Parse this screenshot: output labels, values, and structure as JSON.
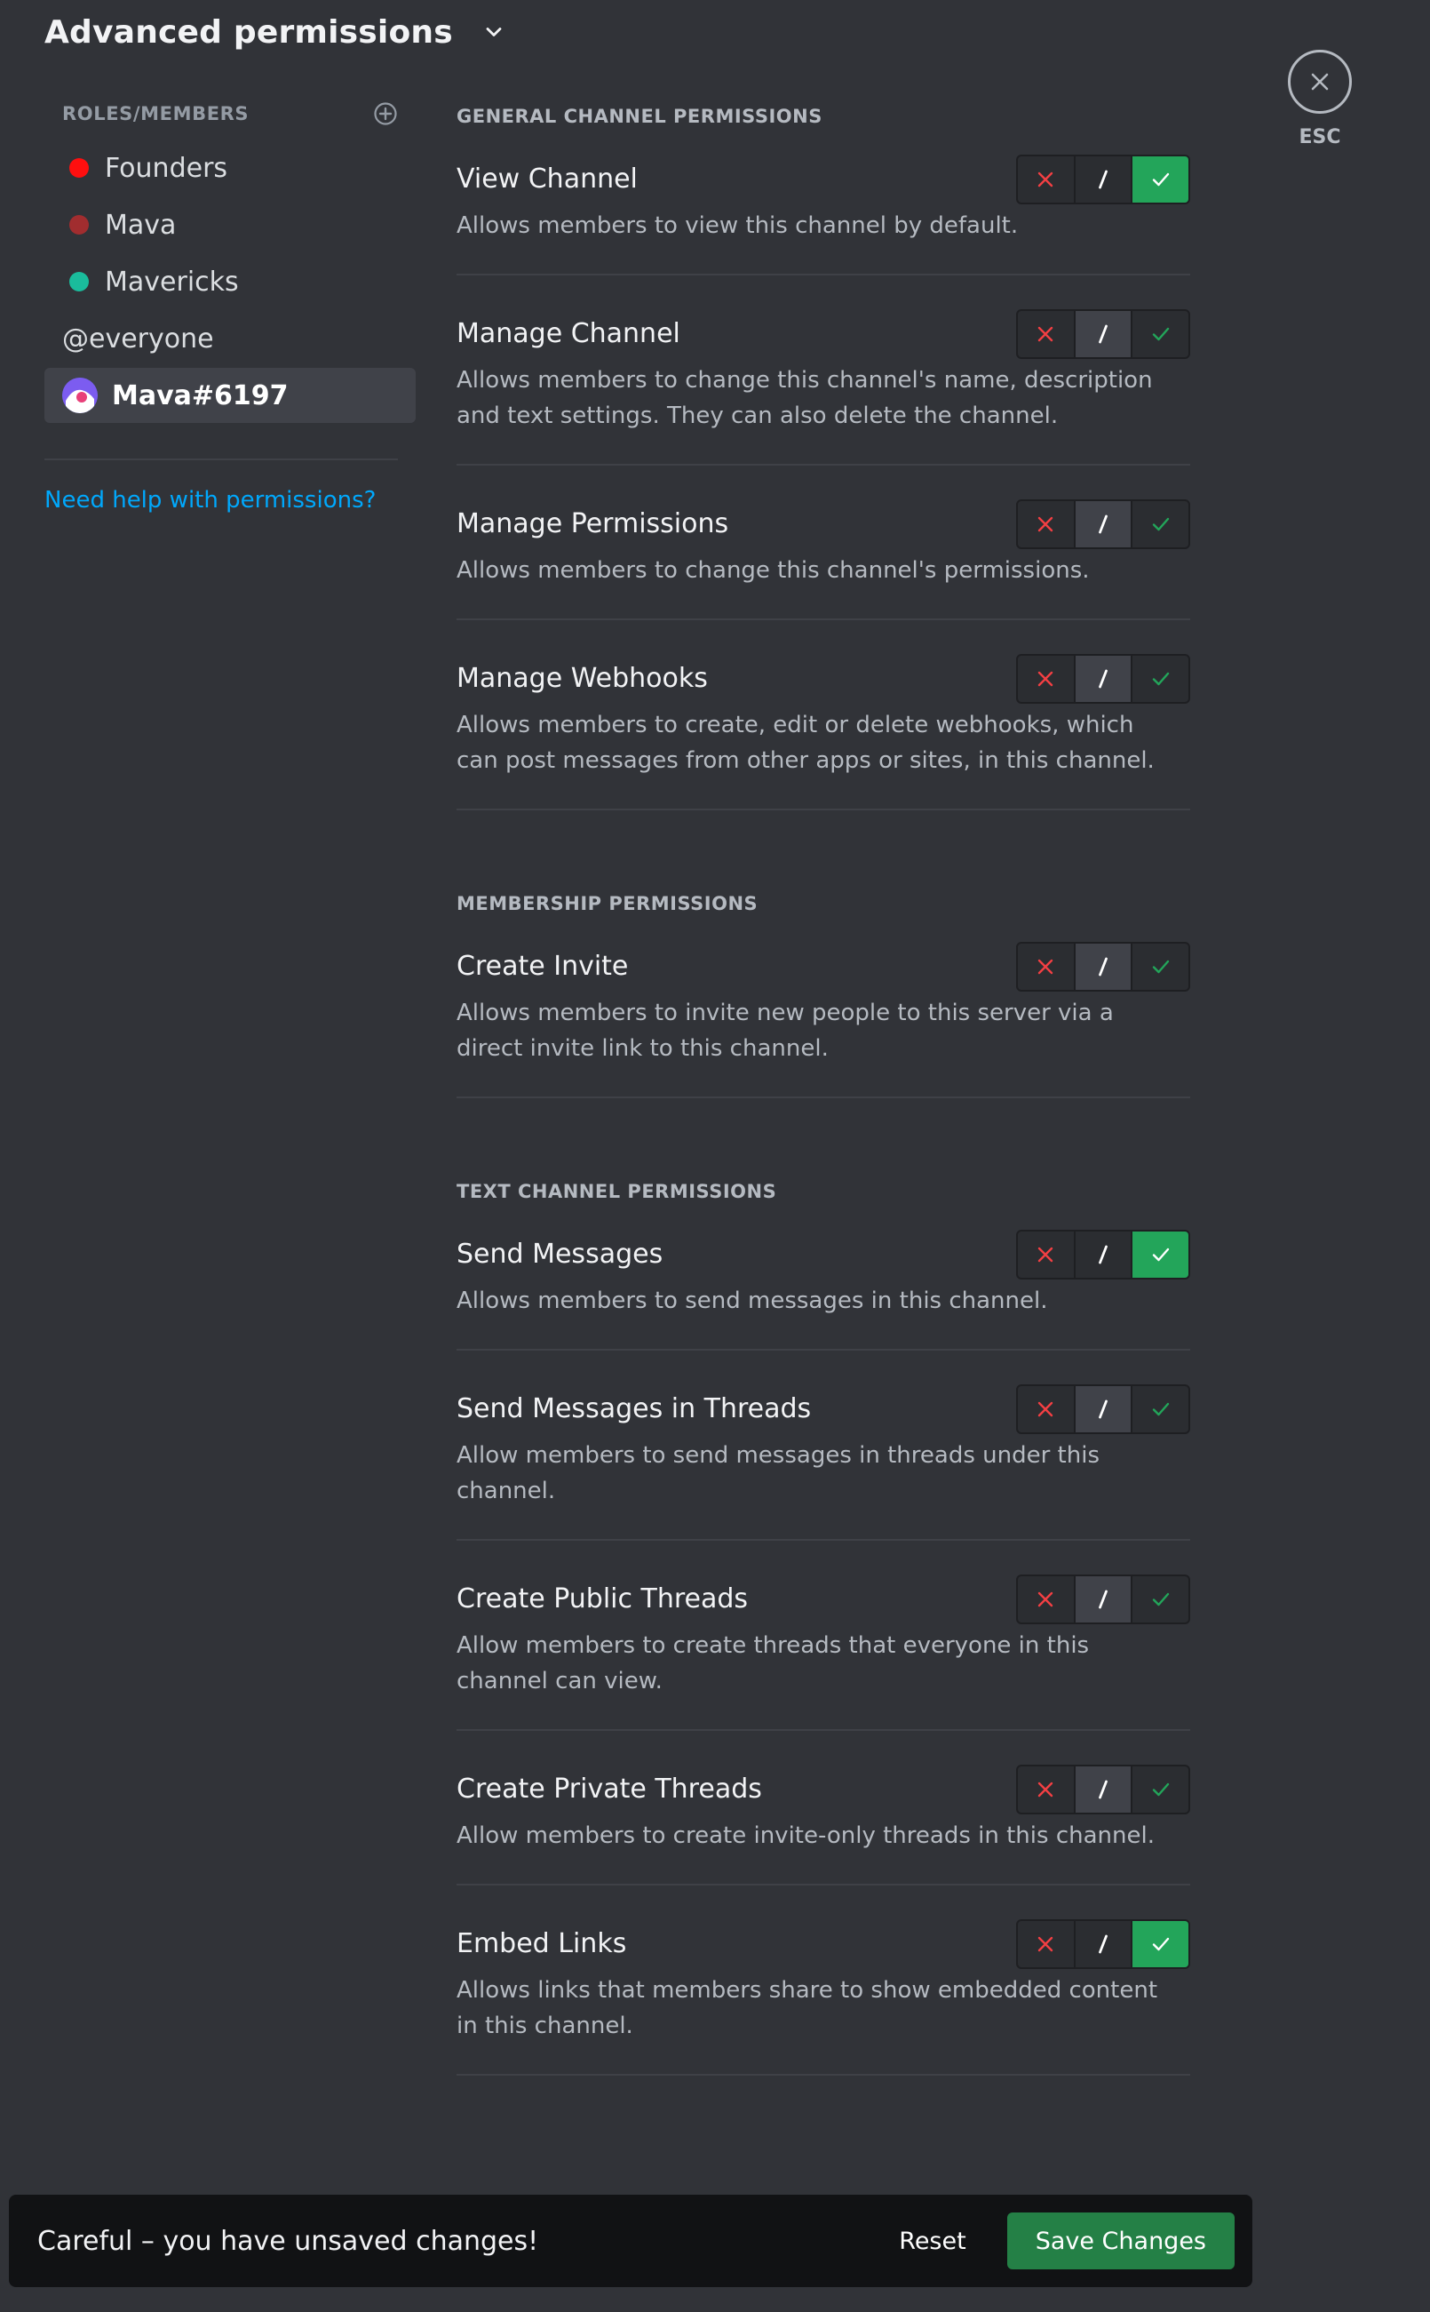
{
  "header": {
    "title": "Advanced permissions"
  },
  "close": {
    "esc_label": "ESC"
  },
  "sidebar": {
    "heading": "ROLES/MEMBERS",
    "roles": [
      {
        "label": "Founders",
        "color": "#ff0f0f"
      },
      {
        "label": "Mava",
        "color": "#a12d2f"
      },
      {
        "label": "Mavericks",
        "color": "#1abc9c"
      }
    ],
    "everyone": "@everyone",
    "selected_member": "Mava#6197",
    "help_link": "Need help with permissions?"
  },
  "sections": {
    "general": "GENERAL CHANNEL PERMISSIONS",
    "membership": "MEMBERSHIP PERMISSIONS",
    "text": "TEXT CHANNEL PERMISSIONS"
  },
  "permissions": {
    "view_channel": {
      "title": "View Channel",
      "desc": "Allows members to view this channel by default.",
      "state": "allow"
    },
    "manage_channel": {
      "title": "Manage Channel",
      "desc": "Allows members to change this channel's name, description and text settings. They can also delete the channel.",
      "state": "neutral"
    },
    "manage_permissions": {
      "title": "Manage Permissions",
      "desc": "Allows members to change this channel's permissions.",
      "state": "neutral"
    },
    "manage_webhooks": {
      "title": "Manage Webhooks",
      "desc": "Allows members to create, edit or delete webhooks, which can post messages from other apps or sites, in this channel.",
      "state": "neutral"
    },
    "create_invite": {
      "title": "Create Invite",
      "desc": "Allows members to invite new people to this server via a direct invite link to this channel.",
      "state": "neutral"
    },
    "send_messages": {
      "title": "Send Messages",
      "desc": "Allows members to send messages in this channel.",
      "state": "allow"
    },
    "send_in_threads": {
      "title": "Send Messages in Threads",
      "desc": "Allow members to send messages in threads under this channel.",
      "state": "neutral"
    },
    "create_public_threads": {
      "title": "Create Public Threads",
      "desc": "Allow members to create threads that everyone in this channel can view.",
      "state": "neutral"
    },
    "create_private_threads": {
      "title": "Create Private Threads",
      "desc": "Allow members to create invite-only threads in this channel.",
      "state": "neutral"
    },
    "embed_links": {
      "title": "Embed Links",
      "desc": "Allows links that members share to show embedded content in this channel.",
      "state": "allow"
    }
  },
  "unsaved_bar": {
    "message": "Careful – you have unsaved changes!",
    "reset_label": "Reset",
    "save_label": "Save Changes"
  },
  "colors": {
    "deny": "#f23f43",
    "allow": "#23a55a",
    "link": "#00a8fc",
    "save_button": "#248046"
  }
}
